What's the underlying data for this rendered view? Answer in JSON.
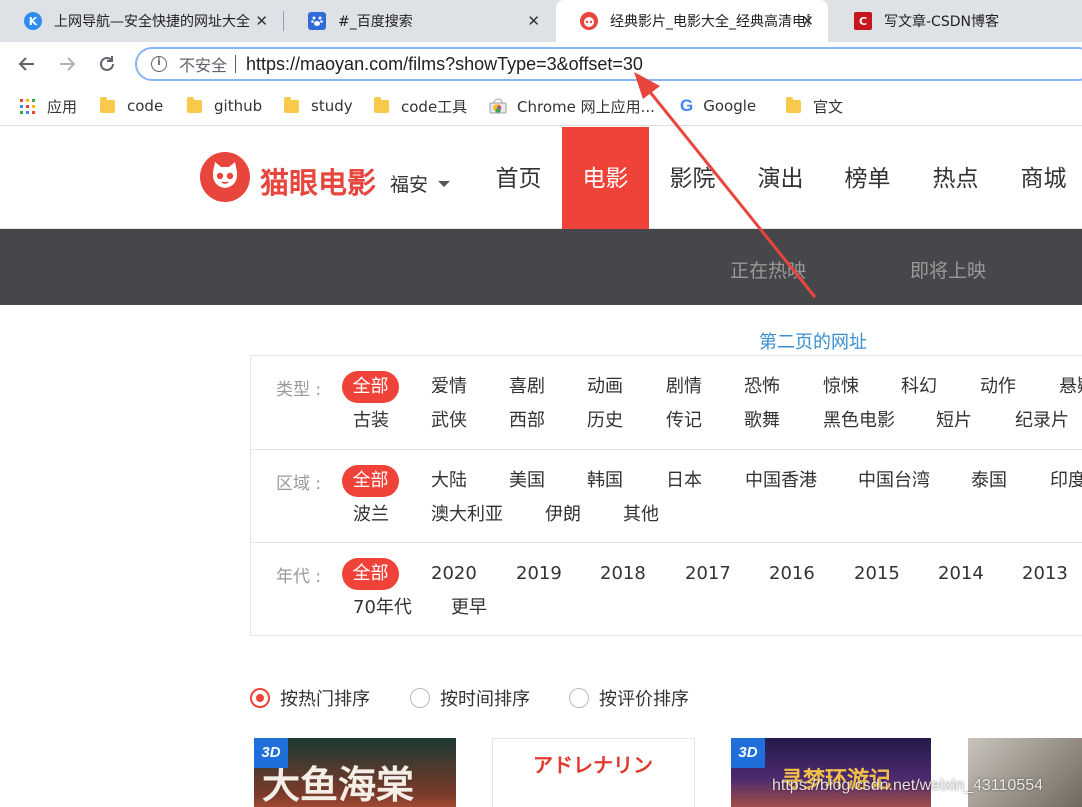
{
  "browser": {
    "tabs": [
      {
        "title": "上网导航—安全快捷的网址大全",
        "favicon": "K",
        "active": false
      },
      {
        "title": "#_百度搜索",
        "favicon": "du",
        "active": false
      },
      {
        "title": "经典影片_电影大全_经典高清电影",
        "favicon": "cat",
        "active": true
      },
      {
        "title": "写文章-CSDN博客",
        "favicon": "C",
        "active": false
      }
    ],
    "close_glyph": "✕",
    "address": {
      "security_label": "不安全",
      "url": "https://maoyan.com/films?showType=3&offset=30"
    },
    "bookmarks": [
      {
        "label": "应用",
        "icon": "apps-grid-icon"
      },
      {
        "label": "code",
        "icon": "folder-icon"
      },
      {
        "label": "github",
        "icon": "folder-icon"
      },
      {
        "label": "study",
        "icon": "folder-icon"
      },
      {
        "label": "code工具",
        "icon": "folder-icon"
      },
      {
        "label": "Chrome 网上应用...",
        "icon": "chrome-webstore-icon"
      },
      {
        "label": "Google",
        "icon": "google-icon"
      },
      {
        "label": "官文",
        "icon": "folder-icon"
      }
    ]
  },
  "site": {
    "logo_text": "猫眼电影",
    "city": "福安",
    "nav": [
      {
        "label": "首页",
        "active": false
      },
      {
        "label": "电影",
        "active": true
      },
      {
        "label": "影院",
        "active": false
      },
      {
        "label": "演出",
        "active": false
      },
      {
        "label": "榜单",
        "active": false
      },
      {
        "label": "热点",
        "active": false
      },
      {
        "label": "商城",
        "active": false
      }
    ],
    "subnav": [
      "正在热映",
      "即将上映"
    ]
  },
  "annotation": "第二页的网址",
  "filters": {
    "type": {
      "label": "类型 :",
      "row1": [
        "全部",
        "爱情",
        "喜剧",
        "动画",
        "剧情",
        "恐怖",
        "惊悚",
        "科幻",
        "动作",
        "悬疑"
      ],
      "row2": [
        "古装",
        "武侠",
        "西部",
        "历史",
        "传记",
        "歌舞",
        "黑色电影",
        "短片",
        "纪录片"
      ]
    },
    "region": {
      "label": "区域 :",
      "row1": [
        "全部",
        "大陆",
        "美国",
        "韩国",
        "日本",
        "中国香港",
        "中国台湾",
        "泰国",
        "印度"
      ],
      "row2": [
        "波兰",
        "澳大利亚",
        "伊朗",
        "其他"
      ]
    },
    "year": {
      "label": "年代 :",
      "row1": [
        "全部",
        "2020",
        "2019",
        "2018",
        "2017",
        "2016",
        "2015",
        "2014",
        "2013"
      ],
      "row2": [
        "70年代",
        "更早"
      ]
    }
  },
  "sort": {
    "options": [
      "按热门排序",
      "按时间排序",
      "按评价排序"
    ],
    "selected": 0
  },
  "posters": [
    {
      "badge": "3D",
      "title": "大鱼海棠"
    },
    {
      "badge": "",
      "title": "アドレナリン"
    },
    {
      "badge": "3D",
      "title": "寻梦环游记"
    },
    {
      "badge": "",
      "title": ""
    }
  ],
  "watermark": "https://blog.csdn.net/weixin_43110554",
  "colors": {
    "brand": "#ef4238",
    "annotation_arrow": "#e8453c",
    "subnav_bg": "#47464a",
    "annotation_text": "#3b8fd1"
  }
}
